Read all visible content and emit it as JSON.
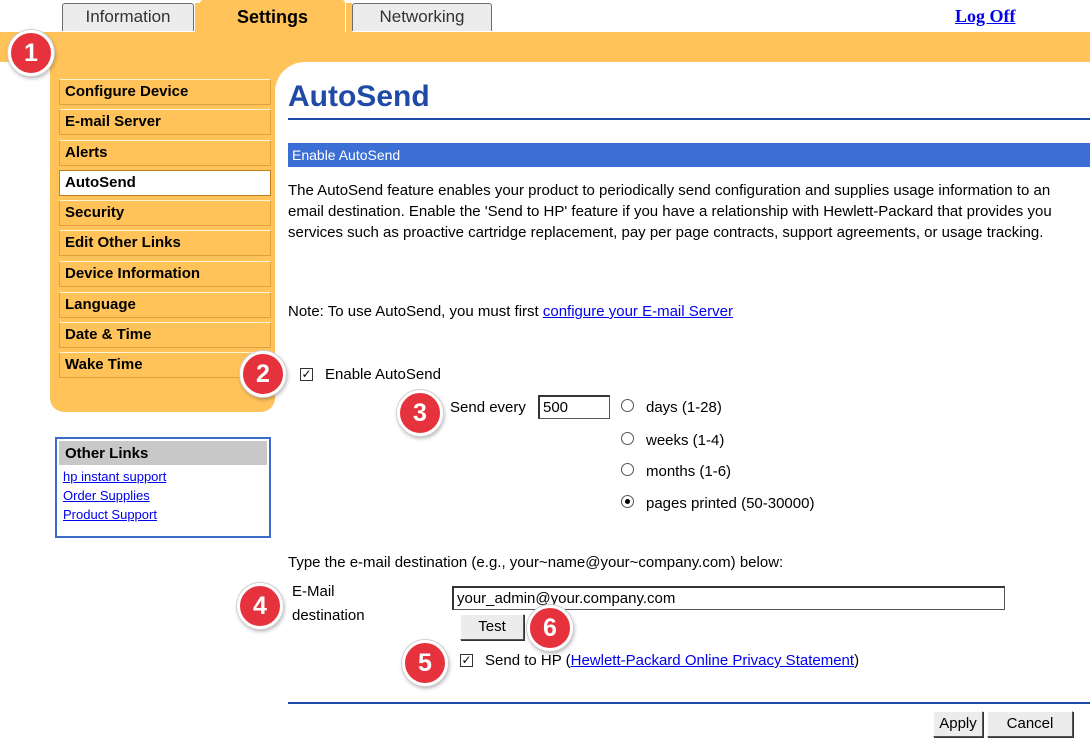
{
  "tabs": [
    "Information",
    "Settings",
    "Networking"
  ],
  "header": {
    "logoff_label": "Log Off"
  },
  "menu": {
    "items": [
      "Configure Device",
      "E-mail Server",
      "Alerts",
      "AutoSend",
      "Security",
      "Edit Other Links",
      "Device Information",
      "Language",
      "Date & Time",
      "Wake Time"
    ],
    "selected": "AutoSend"
  },
  "other_links": {
    "title": "Other Links",
    "links": [
      "hp instant support",
      "Order Supplies",
      "Product Support"
    ]
  },
  "page": {
    "title": "AutoSend",
    "section": "Enable AutoSend",
    "description": "The AutoSend feature enables your product to periodically send configuration and supplies usage information to an email destination. Enable the 'Send to HP' feature if you have a relationship with Hewlett-Packard that provides you services such as proactive cartridge replacement, pay per page contracts, support agreements, or usage tracking.",
    "note_prefix": "Note: To use AutoSend, you must first ",
    "note_link": "configure your E-mail Server"
  },
  "form": {
    "enable_label": "Enable AutoSend",
    "enable_checked": true,
    "send_every_label": "Send every",
    "send_every_value": "500",
    "interval_options": [
      "days (1-28)",
      "weeks (1-4)",
      "months (1-6)",
      "pages printed (50-30000)"
    ],
    "interval_selected": "pages printed (50-30000)",
    "email_instruction": "Type the e-mail destination (e.g., your~name@your~company.com) below:",
    "email_label_1": "E-Mail",
    "email_label_2": "destination",
    "email_value": "your_admin@your.company.com",
    "test_label": "Test",
    "send_to_hp_label": "Send to HP (",
    "send_to_hp_link": "Hewlett-Packard Online Privacy Statement",
    "send_to_hp_suffix": ")",
    "send_to_hp_checked": true
  },
  "buttons": {
    "apply": "Apply",
    "cancel": "Cancel"
  },
  "callouts": [
    "1",
    "2",
    "3",
    "4",
    "5",
    "6"
  ],
  "colors": {
    "orange": "#FFC35A",
    "blue": "#1f4aa8",
    "section_blue": "#3c6fd4",
    "callout_red": "#e6323c"
  }
}
